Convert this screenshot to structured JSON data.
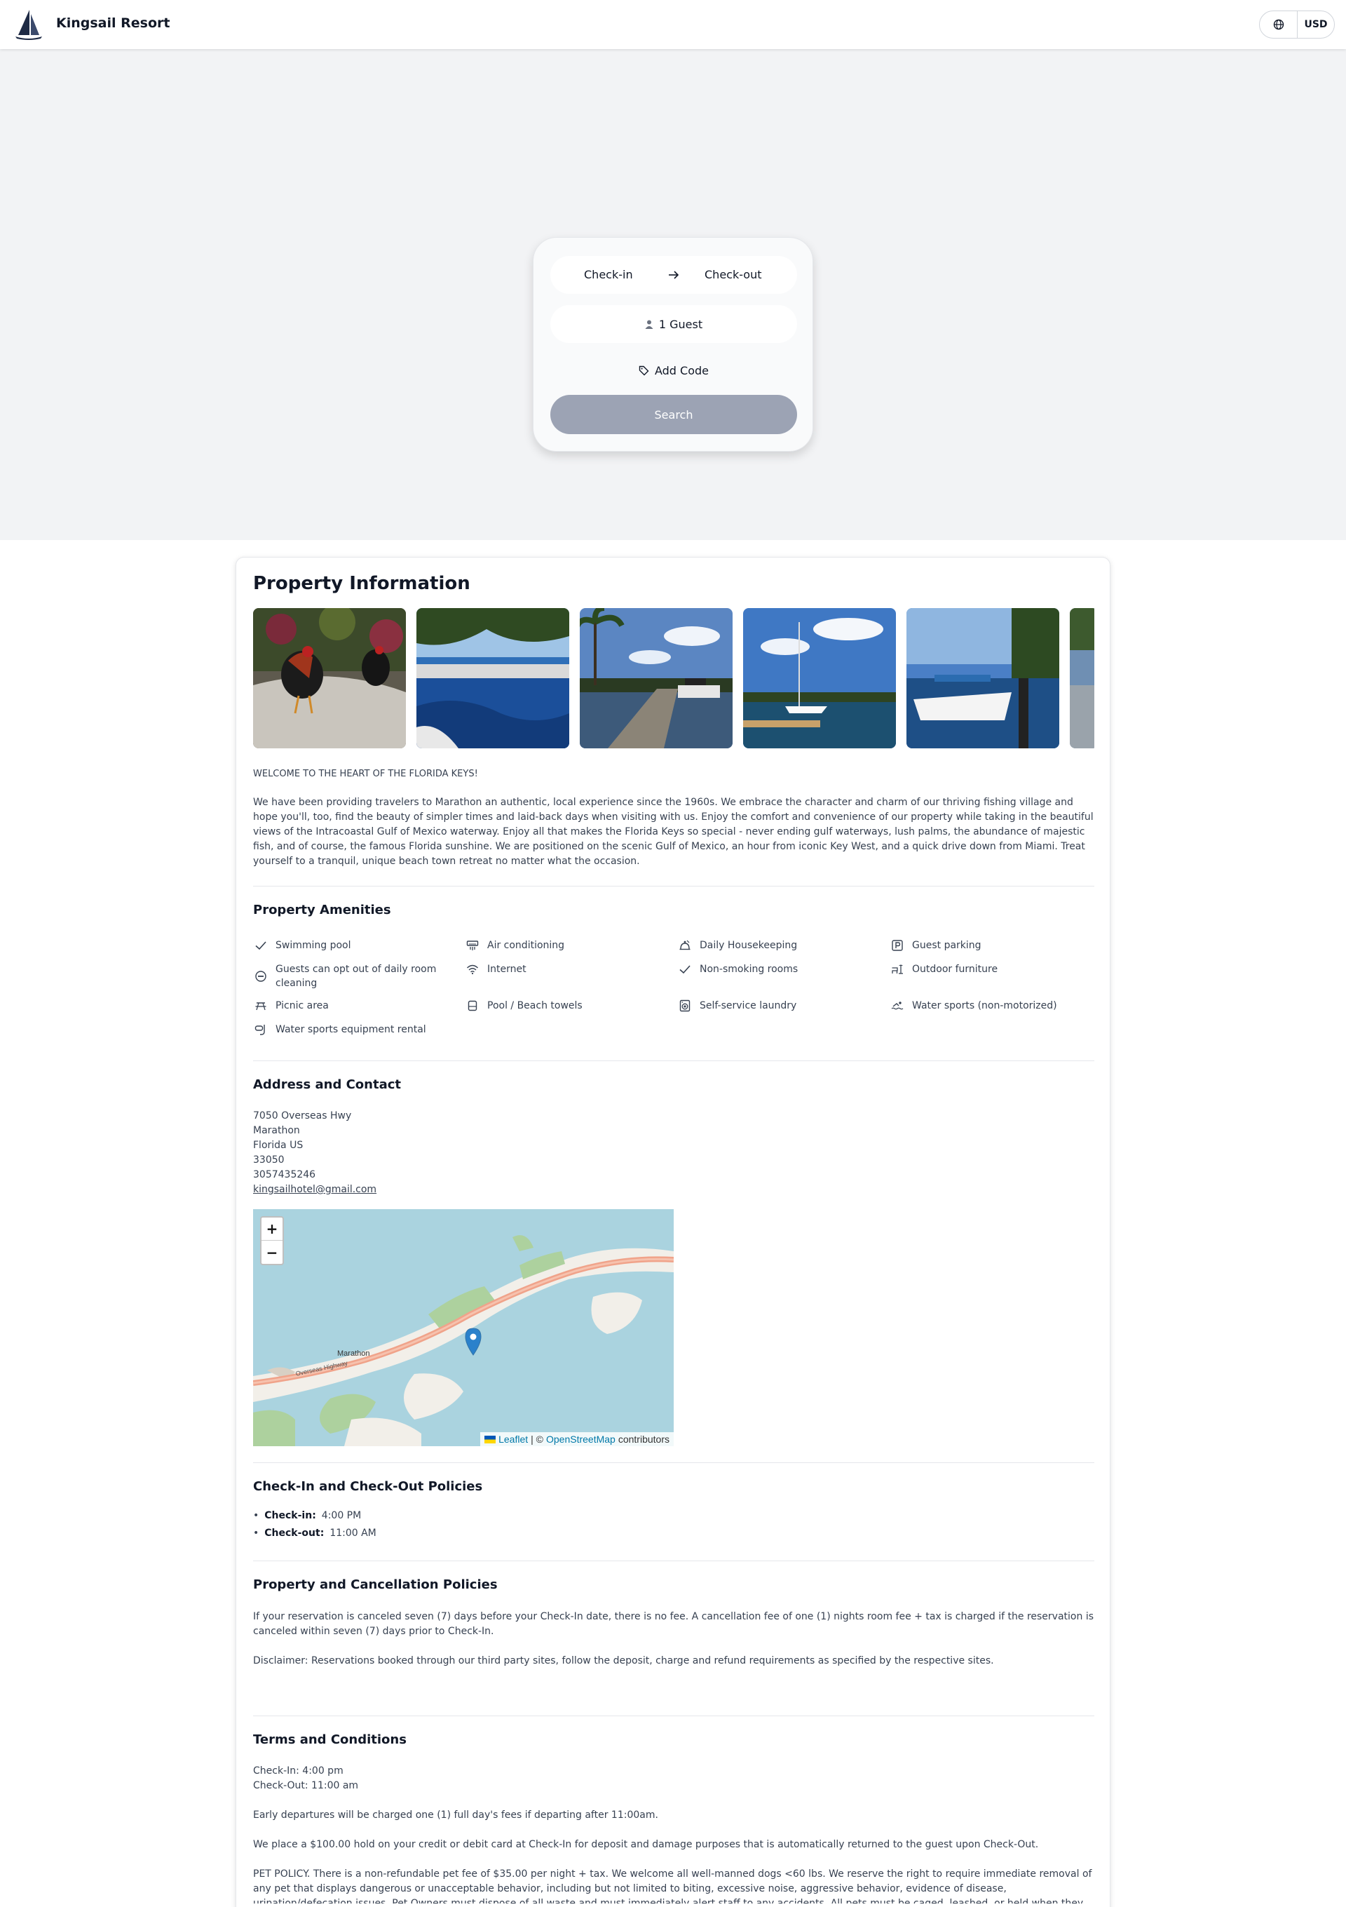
{
  "header": {
    "brand": "Kingsail Resort",
    "currency": "USD"
  },
  "booking": {
    "check_in": "Check-in",
    "check_out": "Check-out",
    "guests": "1 Guest",
    "add_code": "Add Code",
    "search": "Search"
  },
  "property": {
    "title": "Property Information",
    "photos": [
      "roosters-photo",
      "marina-canal-photo",
      "dock-palms-photo",
      "sailboat-bay-photo",
      "boats-docked-photo",
      "partial-photo"
    ],
    "welcome": "WELCOME TO THE HEART OF THE FLORIDA KEYS!",
    "description": "We have been providing travelers to Marathon an authentic, local experience since the 1960s.  We embrace the character and charm of our thriving fishing village and hope you'll, too, find the beauty of simpler times and laid-back days when visiting with us. Enjoy the comfort and convenience of our property while taking in the beautiful views of the Intracoastal Gulf of Mexico waterway. Enjoy all that makes the Florida Keys so special - never ending gulf waterways, lush palms, the abundance of majestic fish, and of course, the famous Florida sunshine. We are positioned on the scenic Gulf of Mexico, an hour from iconic Key West, and a quick drive down from Miami. Treat yourself to a tranquil, unique beach town retreat no matter what the occasion."
  },
  "amenities": {
    "title": "Property Amenities",
    "items": [
      {
        "label": "Swimming pool",
        "icon": "check-icon"
      },
      {
        "label": "Air conditioning",
        "icon": "air-conditioner-icon"
      },
      {
        "label": "Daily Housekeeping",
        "icon": "housekeeping-icon"
      },
      {
        "label": "Guest parking",
        "icon": "parking-icon"
      },
      {
        "label": "Guests can opt out of daily room cleaning",
        "icon": "no-entry-icon"
      },
      {
        "label": "Internet",
        "icon": "wifi-icon"
      },
      {
        "label": "Non-smoking rooms",
        "icon": "check-icon"
      },
      {
        "label": "Outdoor furniture",
        "icon": "outdoor-furniture-icon"
      },
      {
        "label": "Picnic area",
        "icon": "picnic-table-icon"
      },
      {
        "label": "Pool / Beach towels",
        "icon": "towel-icon"
      },
      {
        "label": "Self-service laundry",
        "icon": "laundry-icon"
      },
      {
        "label": "Water sports (non-motorized)",
        "icon": "swimmer-icon"
      },
      {
        "label": "Water sports equipment rental",
        "icon": "snorkel-icon"
      }
    ]
  },
  "address": {
    "title": "Address and Contact",
    "street": "7050 Overseas Hwy",
    "city": "Marathon",
    "state": "Florida US",
    "zip": "33050",
    "phone": "3057435246",
    "email": "kingsailhotel@gmail.com",
    "map": {
      "zoom_in": "+",
      "zoom_out": "−",
      "city_label": "Marathon",
      "road_label": "Overseas Highway",
      "attribution_leaflet": "Leaflet",
      "attribution_sep": "| ©",
      "attribution_osm": "OpenStreetMap",
      "attribution_tail": "contributors"
    }
  },
  "checkin_policies": {
    "title": "Check-In and Check-Out Policies",
    "check_in_label": "Check-in:",
    "check_in_time": "4:00 PM",
    "check_out_label": "Check-out:",
    "check_out_time": "11:00 AM"
  },
  "cancellation": {
    "title": "Property and Cancellation Policies",
    "text": "If your reservation is canceled seven (7) days before your Check-In date, there is no fee.  A cancellation fee of one (1) nights room fee + tax is charged if the reservation is canceled within seven (7) days prior to Check-In.",
    "disclaimer": "Disclaimer: Reservations booked through our third party sites, follow the deposit, charge and refund requirements as specified by the respective sites."
  },
  "terms": {
    "title": "Terms and Conditions",
    "check_in": "Check-In: 4:00 pm",
    "check_out": "Check-Out: 11:00 am",
    "early": "Early departures will be charged one (1) full day's fees if departing after 11:00am.",
    "hold": "We place a $100.00 hold on your credit or debit card at Check-In for deposit and damage purposes that is automatically returned to the guest upon Check-Out.",
    "pet": "PET POLICY. There is a non-refundable pet fee of $35.00 per night + tax.  We welcome all well-manned dogs <60 lbs.  We reserve the right to require immediate removal of any pet that displays dangerous or unacceptable behavior, including but not limited to biting, excessive noise, aggressive behavior, evidence of disease, urination/defecation issues. Pet Owners must dispose of all waste and must immediately alert staff to any accidents. All pets must be caged, leashed, or held when they..."
  },
  "colors": {
    "search_button": "#9ca3b4",
    "hero_bg": "#f2f3f5",
    "map_water": "#aad3df",
    "link": "#0078a8"
  }
}
